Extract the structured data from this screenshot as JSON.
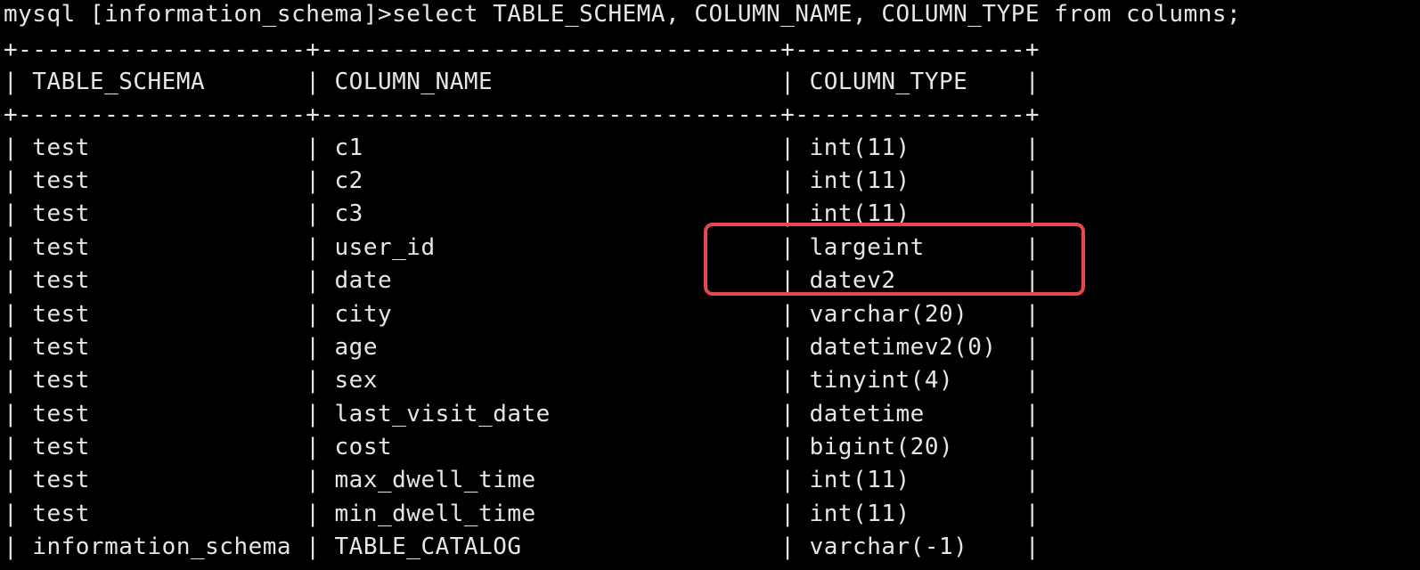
{
  "terminal": {
    "lines": [
      "mysql [information_schema]>select TABLE_SCHEMA, COLUMN_NAME, COLUMN_TYPE from columns;",
      "+--------------------+--------------------------------+----------------+",
      "| TABLE_SCHEMA       | COLUMN_NAME                    | COLUMN_TYPE    |",
      "+--------------------+--------------------------------+----------------+",
      "| test               | c1                             | int(11)        |",
      "| test               | c2                             | int(11)        |",
      "| test               | c3                             | int(11)        |",
      "| test               | user_id                        | largeint       |",
      "| test               | date                           | datev2         |",
      "| test               | city                           | varchar(20)    |",
      "| test               | age                            | datetimev2(0)  |",
      "| test               | sex                            | tinyint(4)     |",
      "| test               | last_visit_date                | datetime       |",
      "| test               | cost                           | bigint(20)     |",
      "| test               | max_dwell_time                 | int(11)        |",
      "| test               | min_dwell_time                 | int(11)        |",
      "| information_schema | TABLE_CATALOG                  | varchar(-1)    |"
    ],
    "highlight_color": "#e5484d",
    "text_color": "#e6e6e6",
    "background": "#000000"
  }
}
